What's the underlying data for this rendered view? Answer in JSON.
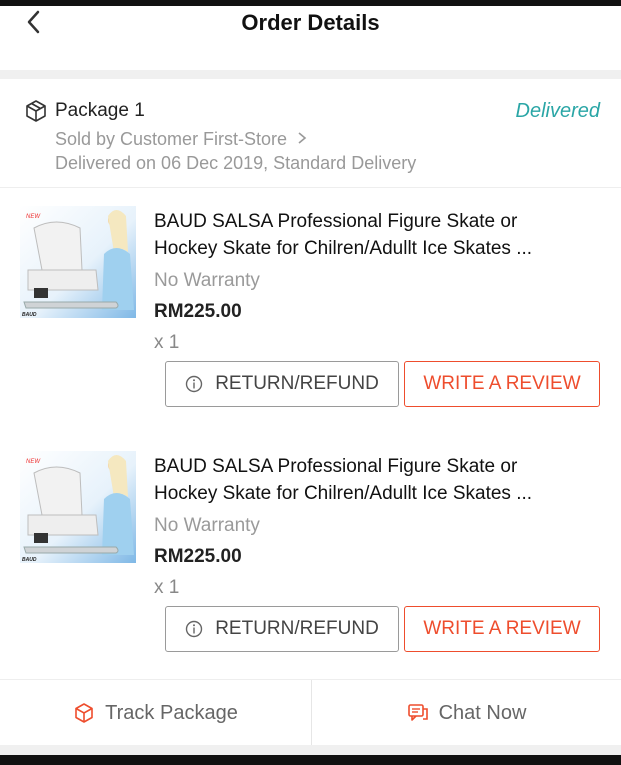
{
  "header": {
    "title": "Order Details",
    "back_icon": "chevron-left-icon"
  },
  "package": {
    "title": "Package 1",
    "status": "Delivered",
    "seller": "Sold by Customer First-Store",
    "delivered": "Delivered on 06 Dec 2019, Standard Delivery",
    "icon": "box-icon",
    "status_color": "#2aa6a6"
  },
  "items": [
    {
      "name_line1": "BAUD SALSA Professional Figure Skate or",
      "name_line2": "Hockey Skate for Chilren/Adullt Ice Skates ...",
      "warranty": "No Warranty",
      "price": "RM225.00",
      "qty": "x 1",
      "return_label": "RETURN/REFUND",
      "review_label": "WRITE A REVIEW",
      "badge": "NEW",
      "brand": "BAUD"
    },
    {
      "name_line1": "BAUD SALSA Professional Figure Skate or",
      "name_line2": "Hockey Skate for Chilren/Adullt Ice Skates ...",
      "warranty": "No Warranty",
      "price": "RM225.00",
      "qty": "x 1",
      "return_label": "RETURN/REFUND",
      "review_label": "WRITE A REVIEW",
      "badge": "NEW",
      "brand": "BAUD"
    }
  ],
  "footer": {
    "track_label": "Track Package",
    "chat_label": "Chat Now",
    "accent": "#ee4d2d"
  }
}
